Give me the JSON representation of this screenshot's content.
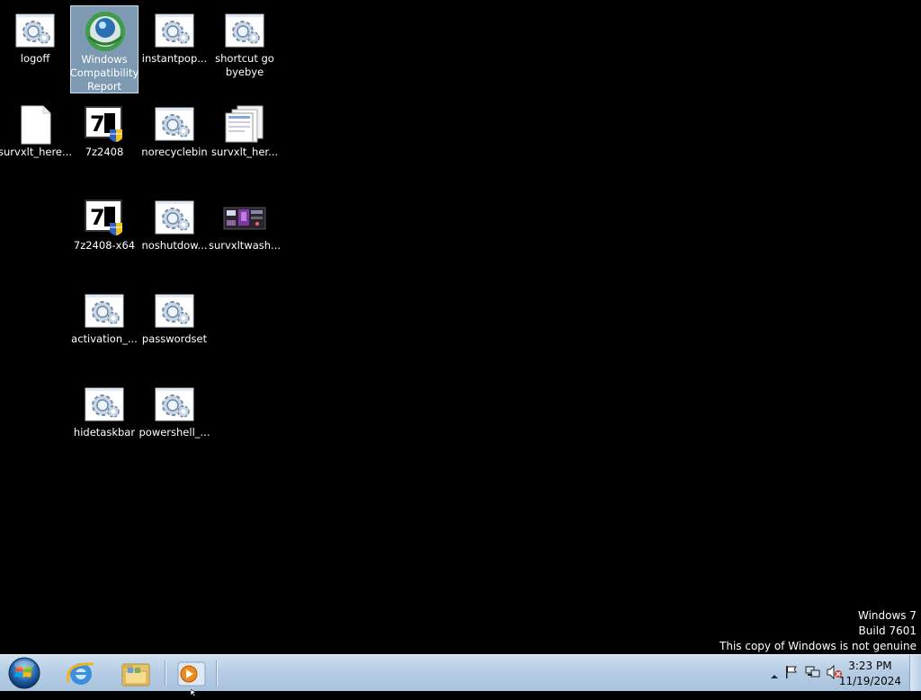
{
  "desktop": {
    "icons": [
      {
        "label": "logoff",
        "icon": "script-gear-icon"
      },
      {
        "label": "Windows Compatibility Report",
        "icon": "compatibility-report-icon"
      },
      {
        "label": "instantpop...",
        "icon": "script-gear-icon"
      },
      {
        "label": "shortcut go byebye",
        "icon": "script-gear-icon"
      },
      {
        "label": "survxlt_here...",
        "icon": "blank-document-icon"
      },
      {
        "label": "7z2408",
        "icon": "7zip-installer-icon"
      },
      {
        "label": "norecyclebin",
        "icon": "script-gear-icon"
      },
      {
        "label": "survxlt_her...",
        "icon": "folder-documents-icon"
      },
      {
        "label": "7z2408-x64",
        "icon": "7zip-installer-icon"
      },
      {
        "label": "noshutdow...",
        "icon": "script-gear-icon"
      },
      {
        "label": "survxltwash...",
        "icon": "image-thumbnail-icon"
      },
      {
        "label": "activation_...",
        "icon": "script-gear-icon"
      },
      {
        "label": "passwordset",
        "icon": "script-gear-icon"
      },
      {
        "label": "hidetaskbar",
        "icon": "script-gear-icon"
      },
      {
        "label": "powershell_...",
        "icon": "script-gear-icon"
      }
    ]
  },
  "watermark": {
    "line1": "Windows 7",
    "line2": "Build 7601",
    "line3": "This copy of Windows is not genuine"
  },
  "taskbar": {
    "pinned": [
      {
        "icon": "internet-explorer-icon"
      },
      {
        "icon": "windows-explorer-icon"
      },
      {
        "icon": "windows-media-player-icon"
      }
    ],
    "clock": {
      "time": "3:23 PM",
      "date": "11/19/2024"
    }
  }
}
